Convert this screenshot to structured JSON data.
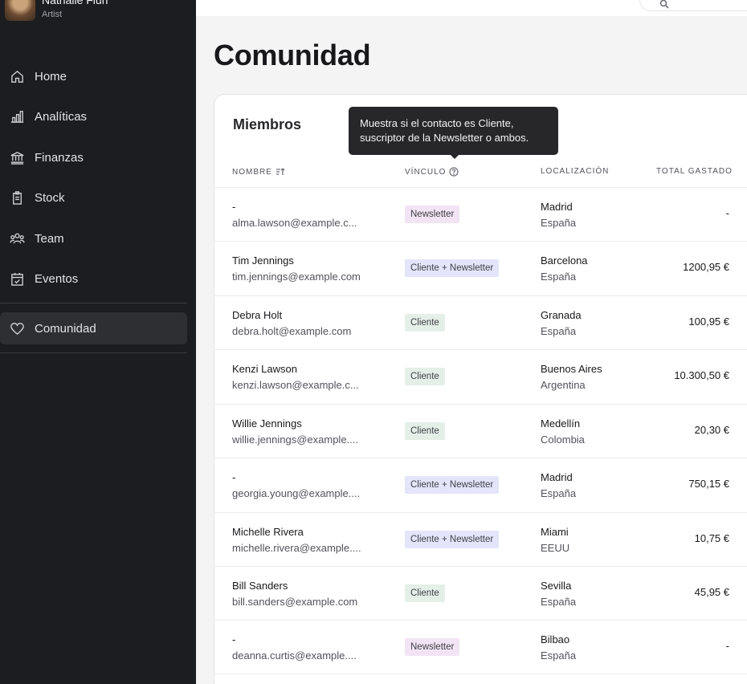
{
  "profile": {
    "name": "Nathalie Fluri",
    "role": "Artist"
  },
  "nav": [
    {
      "label": "Home",
      "icon": "home-icon"
    },
    {
      "label": "Analíticas",
      "icon": "chart-icon"
    },
    {
      "label": "Finanzas",
      "icon": "bank-icon"
    },
    {
      "label": "Stock",
      "icon": "clipboard-icon"
    },
    {
      "label": "Team",
      "icon": "team-icon"
    },
    {
      "label": "Eventos",
      "icon": "calendar-icon"
    },
    {
      "label": "Comunidad",
      "icon": "heart-icon",
      "active": true
    }
  ],
  "page": {
    "title": "Comunidad"
  },
  "card": {
    "title": "Miembros",
    "tooltip_line1": "Muestra si el contacto es Cliente,",
    "tooltip_line2": "suscriptor de la Newsletter o ambos.",
    "headers": {
      "name": "NOMBRE",
      "link": "VÍNCULO",
      "location": "LOCALIZACIÓN",
      "total": "TOTAL GASTADO"
    }
  },
  "rows": [
    {
      "name": "-",
      "email": "alma.lawson@example.c...",
      "link": "Newsletter",
      "type": "news",
      "city": "Madrid",
      "country": "España",
      "total": "-"
    },
    {
      "name": "Tim Jennings",
      "email": "tim.jennings@example.com",
      "link": "Cliente + Newsletter",
      "type": "both",
      "city": "Barcelona",
      "country": "España",
      "total": "1200,95 €"
    },
    {
      "name": "Debra Holt",
      "email": "debra.holt@example.com",
      "link": "Cliente",
      "type": "cli",
      "city": "Granada",
      "country": "España",
      "total": "100,95 €"
    },
    {
      "name": "Kenzi Lawson",
      "email": "kenzi.lawson@example.c...",
      "link": "Cliente",
      "type": "cli",
      "city": "Buenos Aires",
      "country": "Argentina",
      "total": "10.300,50 €"
    },
    {
      "name": "Willie Jennings",
      "email": "willie.jennings@example....",
      "link": "Cliente",
      "type": "cli",
      "city": "Medellín",
      "country": "Colombia",
      "total": "20,30 €"
    },
    {
      "name": "-",
      "email": "georgia.young@example....",
      "link": "Cliente + Newsletter",
      "type": "both",
      "city": "Madrid",
      "country": "España",
      "total": "750,15 €"
    },
    {
      "name": "Michelle Rivera",
      "email": "michelle.rivera@example....",
      "link": "Cliente + Newsletter",
      "type": "both",
      "city": "Miami",
      "country": "EEUU",
      "total": "10,75 €"
    },
    {
      "name": "Bill Sanders",
      "email": "bill.sanders@example.com",
      "link": "Cliente",
      "type": "cli",
      "city": "Sevilla",
      "country": "España",
      "total": "45,95 €"
    },
    {
      "name": "-",
      "email": "deanna.curtis@example....",
      "link": "Newsletter",
      "type": "news",
      "city": "Bilbao",
      "country": "España",
      "total": "-"
    }
  ]
}
